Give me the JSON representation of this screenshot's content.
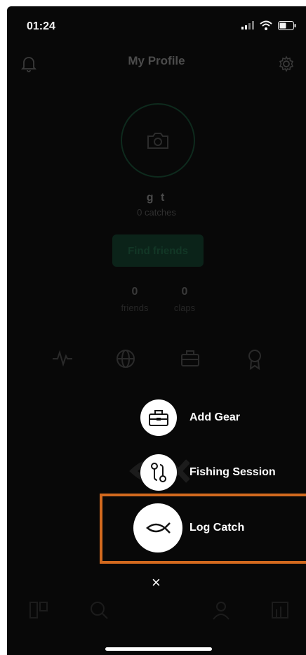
{
  "status": {
    "time": "01:24",
    "icons": [
      "signal-icon",
      "wifi-icon",
      "battery-icon"
    ]
  },
  "header": {
    "title": "My Profile",
    "left_icon": "bell-icon",
    "right_icon": "gear-icon"
  },
  "profile": {
    "avatar_icon": "camera-icon",
    "username": "g t",
    "catches_text": "0 catches",
    "find_friends_label": "Find friends"
  },
  "stats": {
    "friends": {
      "value": "0",
      "label": "friends"
    },
    "claps": {
      "value": "0",
      "label": "claps"
    }
  },
  "profile_tabs": [
    "activity-icon",
    "globe-icon",
    "tackle-box-icon",
    "award-icon"
  ],
  "action_menu": {
    "items": [
      {
        "label": "Add Gear",
        "icon": "tackle-box-icon"
      },
      {
        "label": "Fishing Session",
        "icon": "route-icon"
      },
      {
        "label": "Log Catch",
        "icon": "fish-icon"
      }
    ],
    "close_symbol": "×"
  },
  "bottom_nav": [
    "feed-icon",
    "search-icon",
    "add-icon",
    "profile-icon",
    "stats-icon"
  ],
  "colors": {
    "background": "#080808",
    "accent_green": "#1db36b",
    "highlight": "#d2691e"
  }
}
